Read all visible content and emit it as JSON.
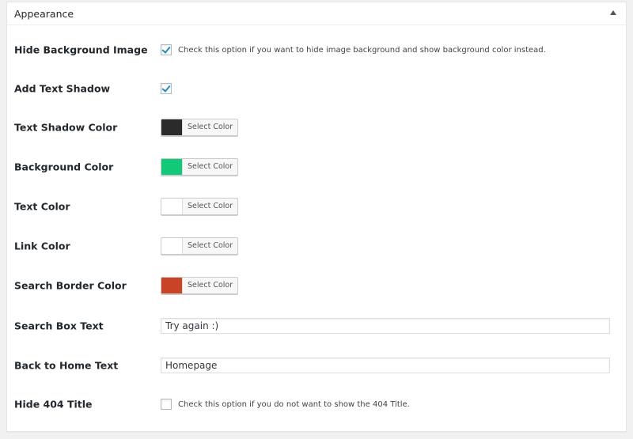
{
  "panel": {
    "title": "Appearance",
    "toggle_icon": "arrow-up-icon"
  },
  "settings": {
    "hide_bg_image": {
      "label": "Hide Background Image",
      "checked": true,
      "description": "Check this option if you want to hide image background and show background color instead."
    },
    "add_text_shadow": {
      "label": "Add Text Shadow",
      "checked": true
    },
    "text_shadow_color": {
      "label": "Text Shadow Color",
      "button": "Select Color",
      "color": "#2b2b2b"
    },
    "background_color": {
      "label": "Background Color",
      "button": "Select Color",
      "color": "#12c97a"
    },
    "text_color": {
      "label": "Text Color",
      "button": "Select Color",
      "color": "#ffffff"
    },
    "link_color": {
      "label": "Link Color",
      "button": "Select Color",
      "color": "#ffffff"
    },
    "search_border_color": {
      "label": "Search Border Color",
      "button": "Select Color",
      "color": "#c94327"
    },
    "search_box_text": {
      "label": "Search Box Text",
      "value": "Try again :)"
    },
    "back_home_text": {
      "label": "Back to Home Text",
      "value": "Homepage"
    },
    "hide_404_title": {
      "label": "Hide 404 Title",
      "checked": false,
      "description": "Check this option if you do not want to show the 404 Title."
    }
  }
}
